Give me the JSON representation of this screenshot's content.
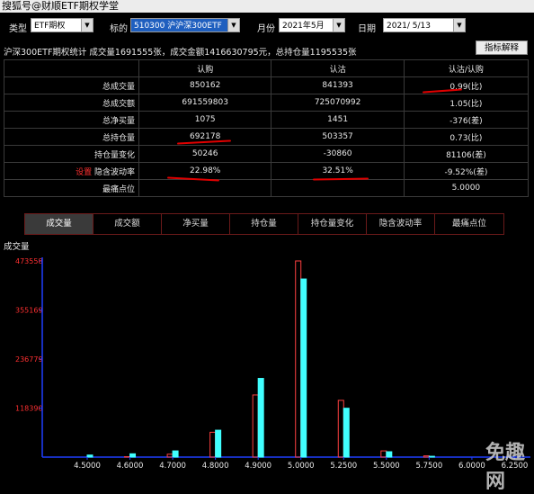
{
  "window": {
    "title": "搜狐号@财顺ETF期权学堂"
  },
  "toolbar": {
    "type_label": "类型",
    "type_value": "ETF期权",
    "target_label": "标的",
    "target_value": "510300 沪沪深300ETF",
    "month_label": "月份",
    "month_value": "2021年5月",
    "date_label": "日期",
    "date_value": "2021/ 5/13"
  },
  "summary": "沪深300ETF期权统计  成交量1691555张，成交金额1416630795元，总持仓量1195535张",
  "help_button": "指标解释",
  "table": {
    "headers": [
      "认购",
      "认沽",
      "认沽/认购"
    ],
    "rows": [
      {
        "label": "总成交量",
        "call": "850162",
        "put": "841393",
        "ratio": "0.99(比)"
      },
      {
        "label": "总成交额",
        "call": "691559803",
        "put": "725070992",
        "ratio": "1.05(比)"
      },
      {
        "label": "总净买量",
        "call": "1075",
        "put": "1451",
        "ratio": "-376(差)"
      },
      {
        "label": "总持仓量",
        "call": "692178",
        "put": "503357",
        "ratio": "0.73(比)"
      },
      {
        "label": "持仓量变化",
        "call": "50246",
        "put": "-30860",
        "ratio": "81106(差)"
      },
      {
        "label": "隐含波动率",
        "prefix": "设置",
        "call": "22.98%",
        "put": "32.51%",
        "ratio": "-9.52%(差)"
      },
      {
        "label": "最痛点位",
        "call": "",
        "put": "",
        "ratio": "5.0000"
      }
    ]
  },
  "tabs": [
    "成交量",
    "成交额",
    "净买量",
    "持仓量",
    "持仓量变化",
    "隐含波动率",
    "最痛点位"
  ],
  "active_tab": 0,
  "chart_data": {
    "type": "bar",
    "ylabel": "成交量",
    "yticks": [
      "473558",
      "355169",
      "236779",
      "118390"
    ],
    "ylim": [
      0,
      473558
    ],
    "categories": [
      "4.5000",
      "4.6000",
      "4.7000",
      "4.8000",
      "4.9000",
      "5.0000",
      "5.2500",
      "5.5000",
      "5.7500",
      "6.0000",
      "6.2500"
    ],
    "series": [
      {
        "name": "认购",
        "color": "#ff4040",
        "values": [
          0,
          1000,
          7000,
          60000,
          150000,
          473558,
          137000,
          15000,
          3000,
          0,
          0
        ]
      },
      {
        "name": "认沽",
        "color": "#40ffff",
        "values": [
          5000,
          8000,
          15000,
          65000,
          190000,
          430000,
          118000,
          13000,
          2000,
          0,
          0
        ]
      }
    ]
  },
  "colors": {
    "call": "#ff4040",
    "put": "#40ffff",
    "axis": "#1f3fff",
    "tick": "#ff3030"
  }
}
